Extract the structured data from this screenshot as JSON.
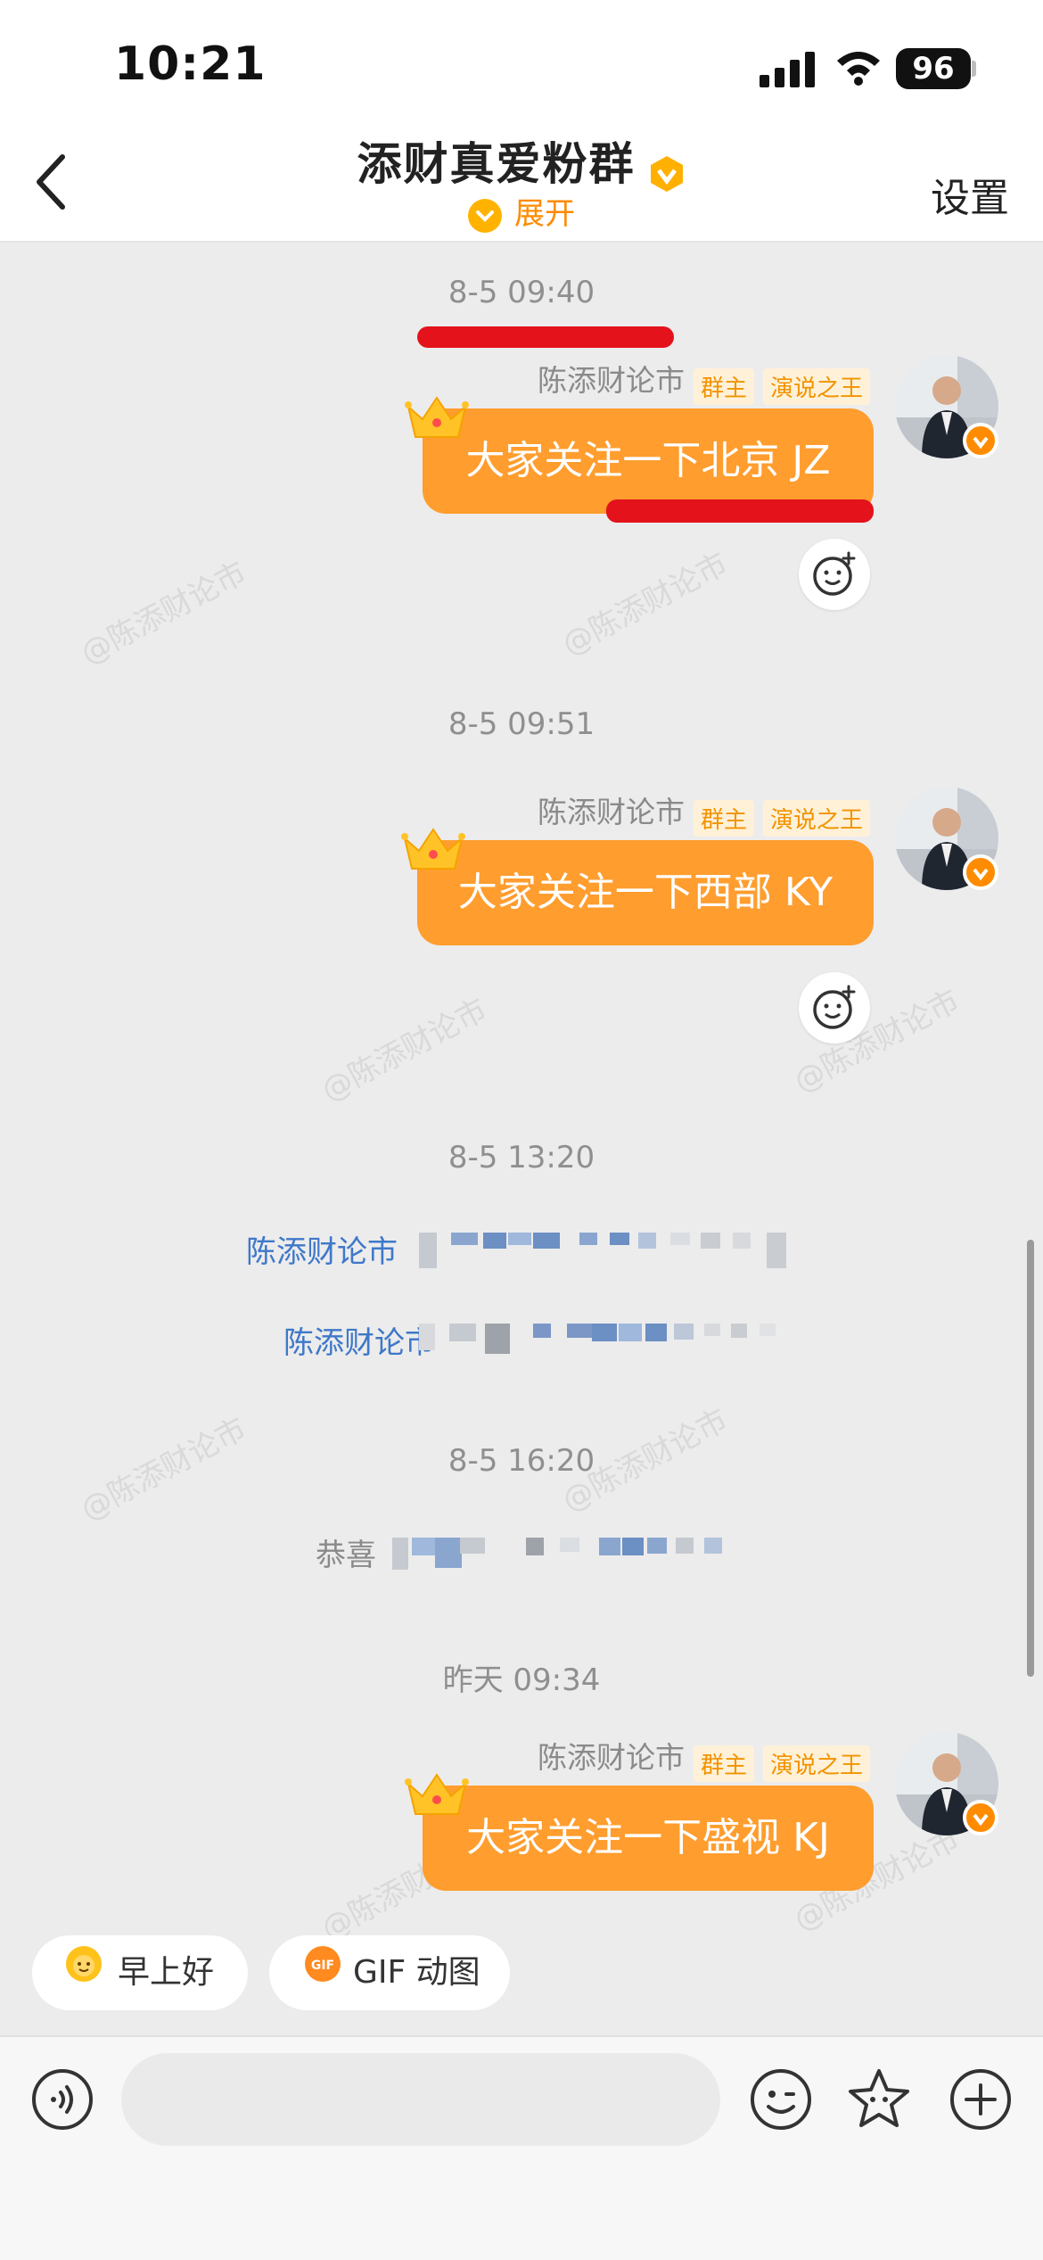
{
  "status_bar": {
    "time": "10:21",
    "battery": "96"
  },
  "header": {
    "title": "添财真爱粉群",
    "expand_label": "展开",
    "settings_label": "设置"
  },
  "watermark_text": "@陈添财论市",
  "messages": [
    {
      "timestamp": "8-5 09:40",
      "sender": "陈添财论市",
      "tags": [
        "群主",
        "演说之王"
      ],
      "text": "大家关注一下北京 JZ"
    },
    {
      "timestamp": "8-5 09:51",
      "sender": "陈添财论市",
      "tags": [
        "群主",
        "演说之王"
      ],
      "text": "大家关注一下西部 KY"
    },
    {
      "timestamp": "8-5 13:20",
      "system_lines": [
        "陈添财论市",
        "陈添财论市"
      ]
    },
    {
      "timestamp": "8-5 16:20",
      "system_text": "恭喜"
    },
    {
      "timestamp": "昨天 09:34",
      "sender": "陈添财论市",
      "tags": [
        "群主",
        "演说之王"
      ],
      "text": "大家关注一下盛视 KJ"
    }
  ],
  "quick_replies": [
    "早上好",
    "GIF 动图"
  ],
  "quick_reply_icons": [
    "sun-face-icon",
    "gif-icon"
  ],
  "input_icons": [
    "voice-icon",
    "emoji-icon",
    "star-sticker-icon",
    "plus-icon"
  ],
  "colors": {
    "bubble": "#ff9d2e",
    "accent": "#ff8a00",
    "link": "#3f78c9",
    "annotation_red": "#e3121b"
  }
}
